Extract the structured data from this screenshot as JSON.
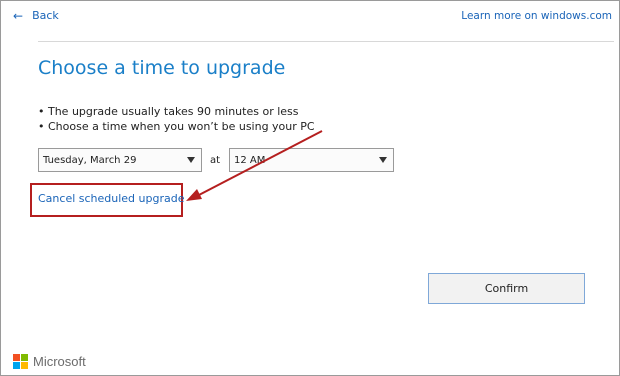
{
  "nav": {
    "back_label": "Back",
    "back_arrow": "←",
    "learn_more": "Learn more on windows.com"
  },
  "main": {
    "title": "Choose a time to upgrade",
    "bullets": [
      "• The upgrade usually takes 90 minutes or less",
      "• Choose a time when you won’t be using your PC"
    ],
    "date_value": "Tuesday, March 29",
    "at_label": "at",
    "time_value": "12 AM",
    "cancel_link": "Cancel scheduled upgrade",
    "confirm_label": "Confirm"
  },
  "footer": {
    "brand": "Microsoft"
  },
  "colors": {
    "link": "#1a64b8",
    "title": "#1a7fc8",
    "annotation": "#b51f1f",
    "logo": [
      "#f25022",
      "#7fba00",
      "#00a4ef",
      "#ffb900"
    ]
  },
  "icons": {
    "back": "arrow-left-icon",
    "dropdown": "chevron-down-icon",
    "logo": "microsoft-logo-icon"
  }
}
